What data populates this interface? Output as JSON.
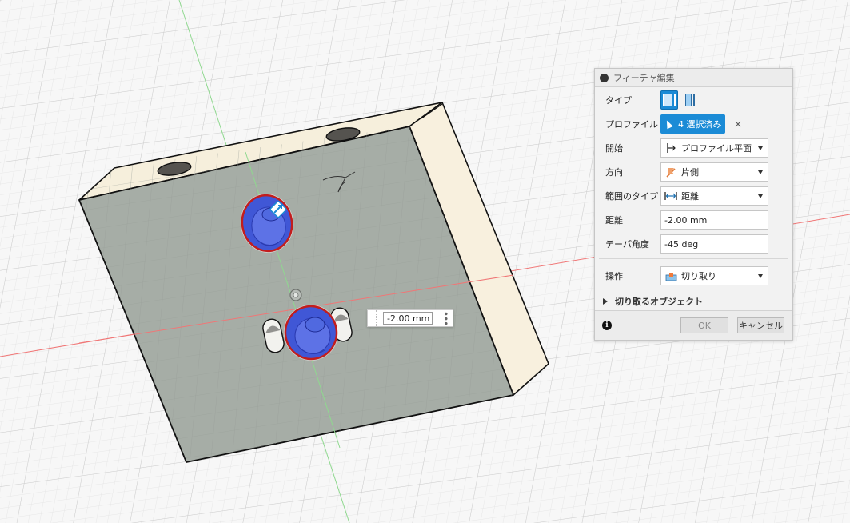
{
  "canvas": {
    "background": "#f7f7f7",
    "grid_color": "#d9d9d9",
    "axis_x_color": "#f06e6e",
    "axis_y_color": "#8fd88f"
  },
  "model": {
    "body_color": "#a4aba4",
    "side_color": "#f7efdc",
    "profile_color": "#3a4fd9",
    "profile_outline_color": "#cc1f1f",
    "selected_profiles": 4
  },
  "dimension_input": {
    "value": "-2.00 mm"
  },
  "dialog": {
    "title": "フィーチャ編集",
    "rows": {
      "type": {
        "label": "タイプ"
      },
      "profile": {
        "label": "プロファイル",
        "value": "4 選択済み",
        "clear": "×"
      },
      "start": {
        "label": "開始",
        "value": "プロファイル平面"
      },
      "direction": {
        "label": "方向",
        "value": "片側"
      },
      "extent_type": {
        "label": "範囲のタイプ",
        "value": "距離"
      },
      "distance": {
        "label": "距離",
        "value": "-2.00 mm"
      },
      "taper": {
        "label": "テーパ角度",
        "value": "-45 deg"
      },
      "operation": {
        "label": "操作",
        "value": "切り取り"
      }
    },
    "objects_to_cut": "切り取るオブジェクト",
    "ok_label": "OK",
    "cancel_label": "キャンセル",
    "accent_color": "#1b8bd6"
  }
}
